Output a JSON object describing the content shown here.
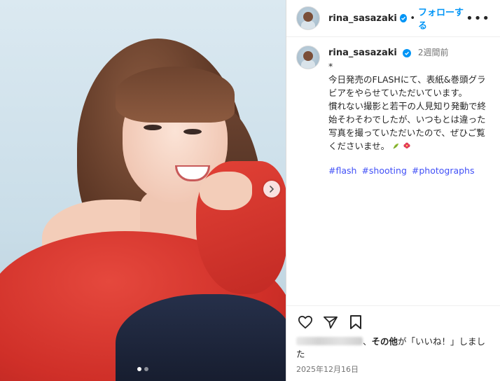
{
  "author": {
    "username": "rina_sasazaki",
    "follow_label": "フォローする",
    "separator": "•",
    "more_label": "•••"
  },
  "caption": {
    "username": "rina_sasazaki",
    "time": "2週間前",
    "text": "*\n今日発売のFLASHにて、表紙&巻頭グラビアをやらせていただいています。\n慣れない撮影と若干の人見知り発動で終始そわそわでしたが、いつもとは違った写真を撮っていただいたので、ぜひご覧くださいませ。",
    "hashtags": [
      "#flash",
      "#shooting",
      "#photographs"
    ]
  },
  "media": {
    "slide_count": 2,
    "current_slide": 1
  },
  "likes": {
    "prefix": "、",
    "others": "その他",
    "suffix": "が「いいね！」しました"
  },
  "date": "2025年12月16日",
  "icons": {
    "like": "heart-icon",
    "share": "send-icon",
    "save": "bookmark-icon",
    "next": "chevron-right-icon",
    "verified": "verified-badge-icon"
  },
  "colors": {
    "accent": "#0095f6",
    "hashtag": "#4150f7",
    "sweater": "#cf2f28"
  }
}
